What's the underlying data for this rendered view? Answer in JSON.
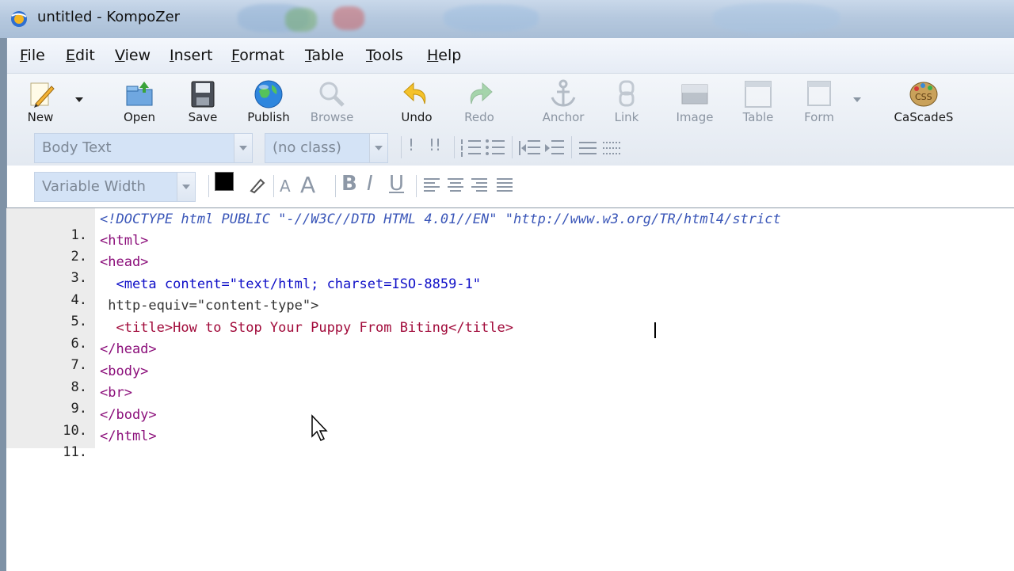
{
  "window": {
    "title": "untitled - KompoZer"
  },
  "menu": [
    {
      "label": "File",
      "u": "F",
      "rest": "ile"
    },
    {
      "label": "Edit",
      "u": "E",
      "rest": "dit"
    },
    {
      "label": "View",
      "u": "V",
      "rest": "iew"
    },
    {
      "label": "Insert",
      "u": "I",
      "rest": "nsert"
    },
    {
      "label": "Format",
      "u": "F",
      "rest": "ormat"
    },
    {
      "label": "Table",
      "u": "T",
      "rest": "able"
    },
    {
      "label": "Tools",
      "u": "T",
      "rest": "ools"
    },
    {
      "label": "Help",
      "u": "H",
      "rest": "elp"
    }
  ],
  "toolbar": {
    "new": "New",
    "open": "Open",
    "save": "Save",
    "publish": "Publish",
    "browse": "Browse",
    "undo": "Undo",
    "redo": "Redo",
    "anchor": "Anchor",
    "link": "Link",
    "image": "Image",
    "table": "Table",
    "form": "Form",
    "cascades": "CaScadeS"
  },
  "format": {
    "paragraph_style": "Body Text",
    "class_select": "(no class)",
    "font_select": "Variable Width",
    "text_color": "#000000"
  },
  "code_lines": [
    {
      "n": "1.",
      "text": "<!DOCTYPE html PUBLIC \"-//W3C//DTD HTML 4.01//EN\" \"http://www.w3.org/TR/html4/strict"
    },
    {
      "n": "2.",
      "text": "<html>"
    },
    {
      "n": "3.",
      "text": "<head>"
    },
    {
      "n": "4.",
      "text": "  <meta content=\"text/html; charset=ISO-8859-1\""
    },
    {
      "n": "5.",
      "text": " http-equiv=\"content-type\">"
    },
    {
      "n": "6.",
      "text": "  <title>How to Stop Your Puppy From Biting</title>"
    },
    {
      "n": "7.",
      "text": "</head>"
    },
    {
      "n": "8.",
      "text": "<body>"
    },
    {
      "n": "9.",
      "text": "<br>"
    },
    {
      "n": "10.",
      "text": "</body>"
    },
    {
      "n": "11.",
      "text": "</html>"
    }
  ]
}
